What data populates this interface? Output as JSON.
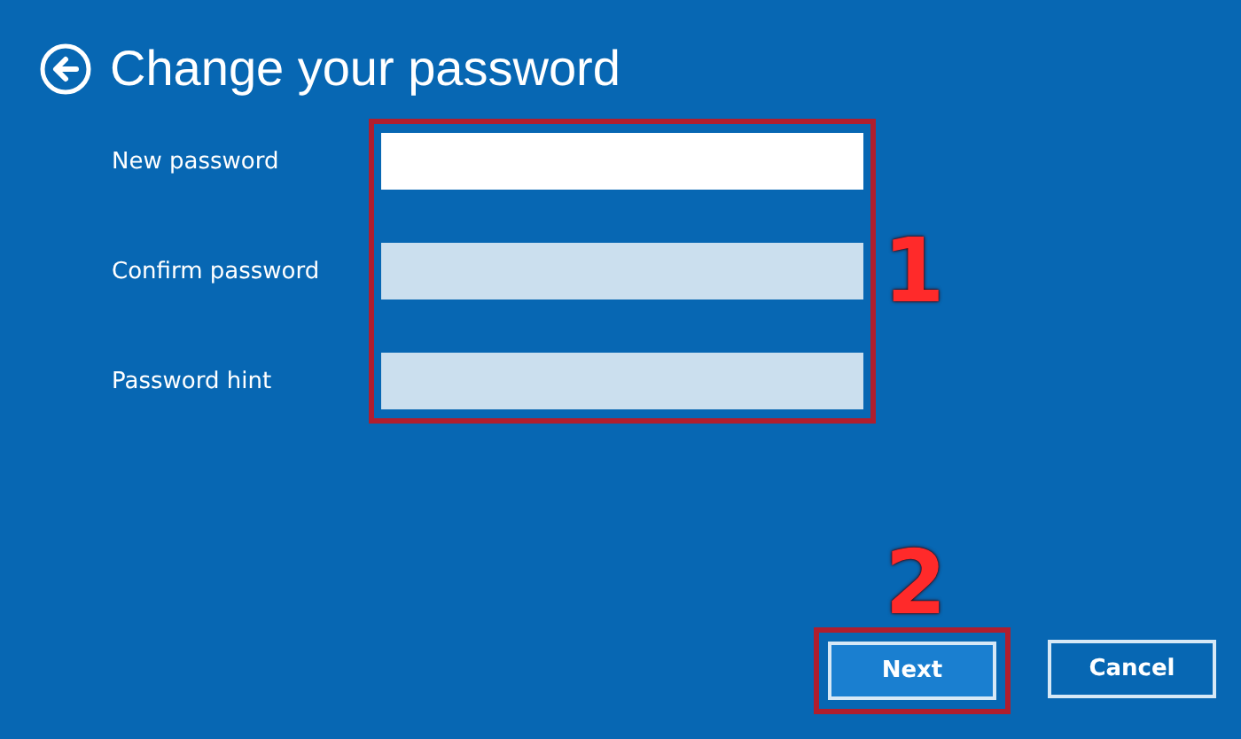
{
  "title": "Change your password",
  "fields": [
    {
      "label": "New password",
      "focused": true
    },
    {
      "label": "Confirm password",
      "focused": false
    },
    {
      "label": "Password hint",
      "focused": false
    }
  ],
  "annotations": {
    "fields_number": "1",
    "button_number": "2"
  },
  "buttons": [
    {
      "label": "Next",
      "default": true
    },
    {
      "label": "Cancel",
      "default": false
    }
  ]
}
